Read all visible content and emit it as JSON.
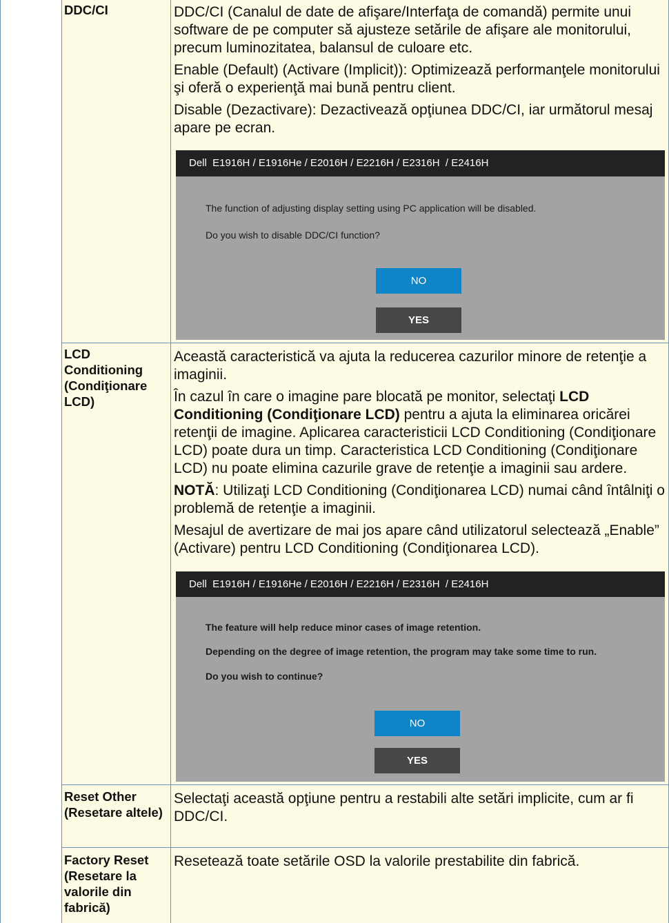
{
  "rows": {
    "ddc": {
      "label": "DDC/CI",
      "p1": "DDC/CI (Canalul de date de afişare/Interfaţa de comandă) permite unui software de pe computer să ajusteze setările de afişare ale monitorului, precum luminozitatea, balansul de culoare etc.",
      "p2": "Enable (Default) (Activare (Implicit)): Optimizează performanţele monitorului şi oferă o experienţă mai bună pentru client.",
      "p3": "Disable (Dezactivare): Dezactivează opţiunea DDC/CI, iar următorul mesaj apare pe ecran."
    },
    "lcd": {
      "label": "LCD Conditioning (Condiţionare LCD)",
      "p1": "Această caracteristică va ajuta la reducerea cazurilor minore de retenţie a imaginii.",
      "p2_a": "În cazul în care o imagine pare blocată pe monitor, selectaţi ",
      "p2_b": "LCD Conditioning (Condiţionare LCD)",
      "p2_c": " pentru a ajuta la eliminarea oricărei retenţii de imagine. Aplicarea caracteristicii LCD Conditioning (Condiţionare LCD) poate dura un timp. Caracteristica LCD Conditioning (Condiţionare LCD) nu poate elimina cazurile grave de retenţie a imaginii sau ardere.",
      "p3_a": "NOTĂ",
      "p3_b": ": Utilizaţi LCD Conditioning (Condiţionarea LCD) numai când întâlniţi o problemă de retenţie a imaginii.",
      "p4": "Mesajul de avertizare de mai jos apare când utilizatorul selectează „Enable” (Activare) pentru LCD Conditioning (Condiţionarea LCD)."
    },
    "reset_other": {
      "label": "Reset Other (Resetare altele)",
      "desc": "Selectaţi această opţiune pentru a restabili alte setări implicite, cum ar fi DDC/CI."
    },
    "factory": {
      "label": "Factory Reset (Resetare la valorile din fabrică)",
      "desc": "Resetează toate setările OSD la valorile prestabilite din fabrică."
    }
  },
  "osd1": {
    "title": "Dell  E1916H / E1916He / E2016H / E2216H / E2316H  / E2416H",
    "line1": "The function of adjusting display setting using PC application will be disabled.",
    "line2": "Do you wish to disable DDC/CI function?",
    "no_label": "NO",
    "yes_label": "YES"
  },
  "osd2": {
    "title": "Dell  E1916H / E1916He / E2016H / E2216H / E2316H  / E2416H",
    "line1": "The feature will help reduce minor cases of image retention.",
    "line2": "Depending on the degree of image retention, the program may take some time to run.",
    "line3": "Do you wish to continue?",
    "no_label": "NO",
    "yes_label": "YES"
  },
  "colors": {
    "cell_bg": "#fdfbe3",
    "border": "#6b93b8",
    "osd_bg": "#a3a3a3",
    "osd_title_bg": "#222222",
    "no_button": "#0f84c7",
    "yes_button": "#474747"
  }
}
